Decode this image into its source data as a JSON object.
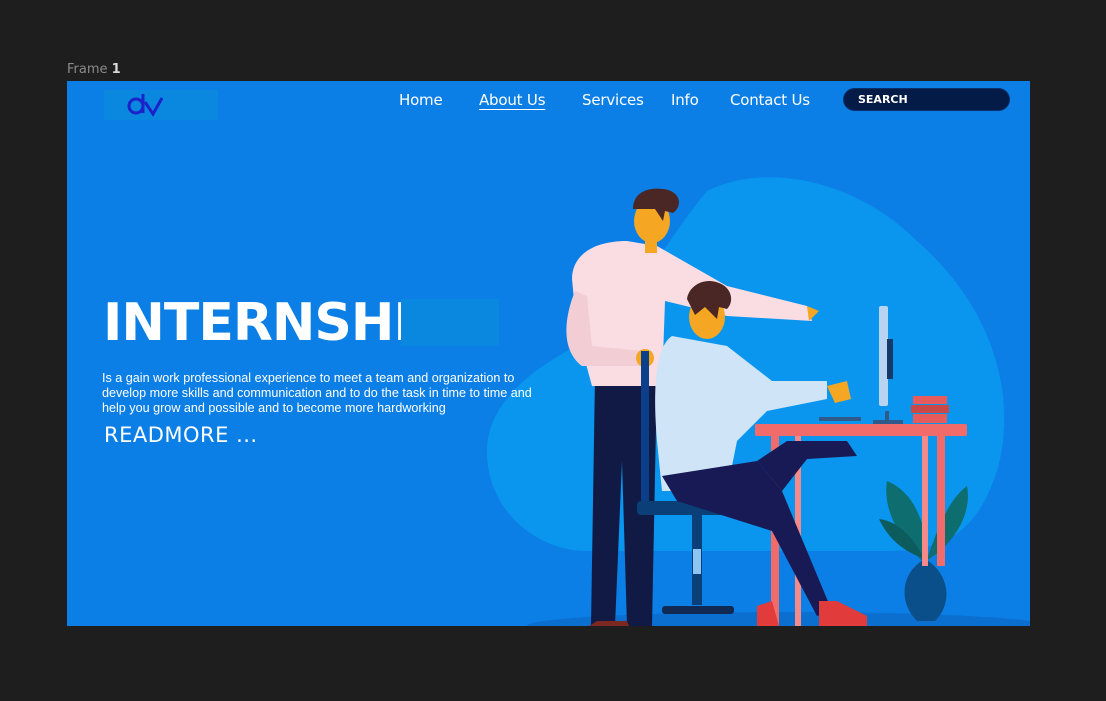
{
  "frame": {
    "label": "Frame",
    "number": "1"
  },
  "logo": {
    "text": "dv"
  },
  "nav": {
    "items": [
      {
        "label": "Home"
      },
      {
        "label": "About Us",
        "active": true
      },
      {
        "label": "Services"
      },
      {
        "label": "Info"
      },
      {
        "label": "Contact Us"
      }
    ]
  },
  "search": {
    "placeholder": "SEARCH"
  },
  "hero": {
    "title": "INTERNSHIP",
    "text": "Is a gain work professional experience to meet a team and organization to develop more skills and communication and to do the task in time to time and help you grow and possible and to become more hardworking",
    "readmore": "READMORE ..."
  },
  "colors": {
    "background": "#1e1e1e",
    "canvas": "#0c7fe6",
    "search_bg": "#041b47",
    "desk": "#f26b6b"
  }
}
